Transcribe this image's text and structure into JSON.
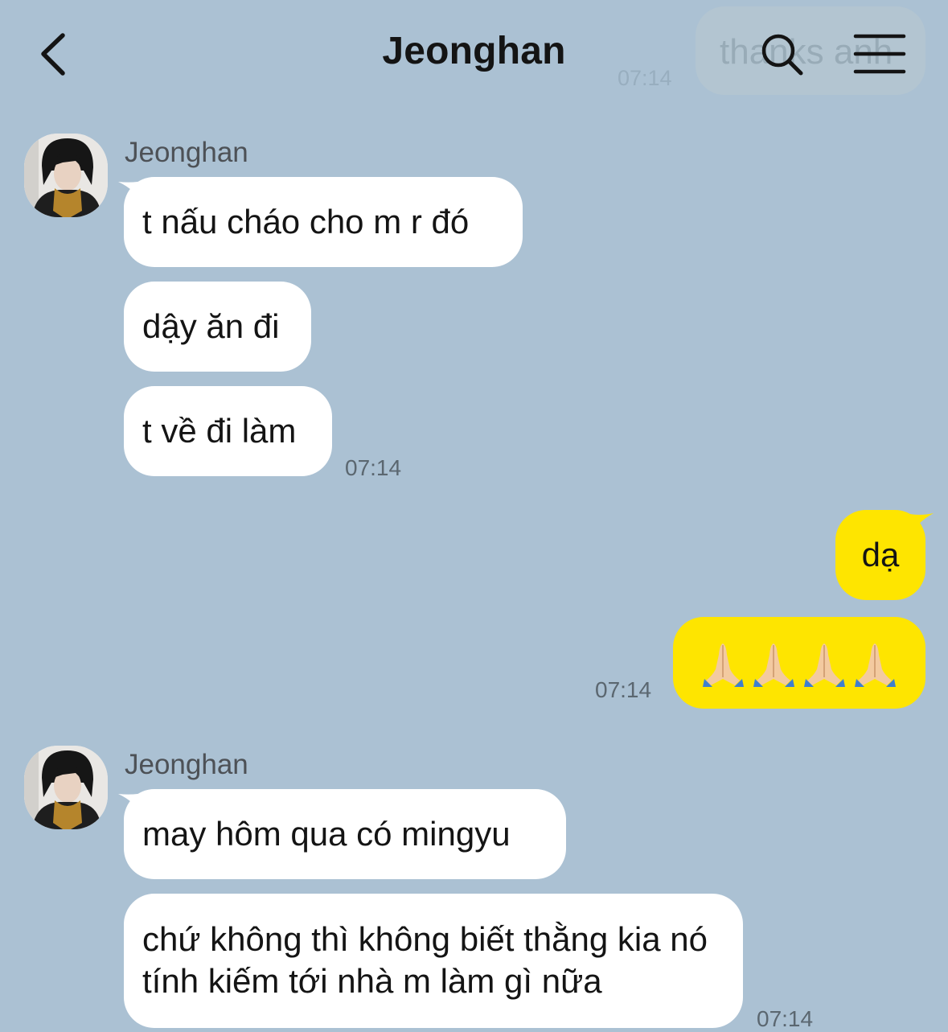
{
  "header": {
    "title": "Jeonghan",
    "ghost_text": "thanks anh",
    "ghost_time": "07:14",
    "back_icon": "chevron-left-icon",
    "search_icon": "search-icon",
    "menu_icon": "hamburger-menu-icon"
  },
  "colors": {
    "background": "#abc1d3",
    "incoming_bubble": "#ffffff",
    "outgoing_bubble": "#fee500"
  },
  "groups": [
    {
      "sender": "Jeonghan",
      "avatar": "avatar-photo",
      "messages": [
        "t nấu cháo cho m r đó",
        "dậy ăn đi",
        "t về đi làm"
      ],
      "time": "07:14"
    },
    {
      "sender": "me",
      "messages": [
        "dạ",
        "🙏🙏🙏🙏"
      ],
      "time": "07:14"
    },
    {
      "sender": "Jeonghan",
      "avatar": "avatar-photo",
      "messages": [
        "may hôm qua có mingyu",
        "chứ không thì không biết thằng kia nó tính kiếm tới nhà m làm gì nữa"
      ],
      "time": "07:14"
    }
  ]
}
